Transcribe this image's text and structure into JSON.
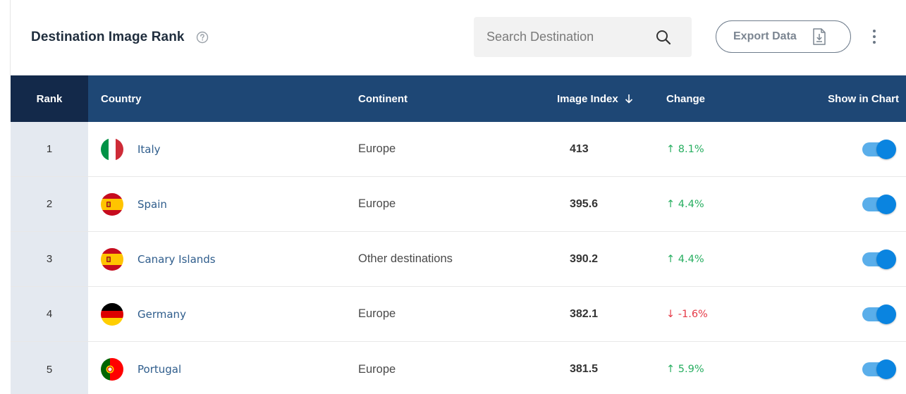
{
  "header": {
    "title": "Destination Image Rank",
    "help_icon": "help-circle-icon",
    "search": {
      "placeholder": "Search Destination",
      "value": "",
      "icon": "search-icon"
    },
    "export": {
      "label": "Export Data",
      "icon": "download-file-icon"
    },
    "more_icon": "more-vertical-icon"
  },
  "table": {
    "columns": {
      "rank": "Rank",
      "country": "Country",
      "continent": "Continent",
      "image_index": "Image Index",
      "change": "Change",
      "show": "Show in Chart"
    },
    "sort": {
      "column": "image_index",
      "direction": "descending",
      "icon": "arrow-down-icon"
    },
    "rows": [
      {
        "rank": "1",
        "country": "Italy",
        "flag": "italy-flag-icon",
        "continent": "Europe",
        "image_index": "413",
        "change": "↑ 8.1%",
        "change_dir": "up",
        "show_in_chart": true
      },
      {
        "rank": "2",
        "country": "Spain",
        "flag": "spain-flag-icon",
        "continent": "Europe",
        "image_index": "395.6",
        "change": "↑ 4.4%",
        "change_dir": "up",
        "show_in_chart": true
      },
      {
        "rank": "3",
        "country": "Canary Islands",
        "flag": "spain-flag-icon",
        "continent": "Other destinations",
        "image_index": "390.2",
        "change": "↑ 4.4%",
        "change_dir": "up",
        "show_in_chart": true
      },
      {
        "rank": "4",
        "country": "Germany",
        "flag": "germany-flag-icon",
        "continent": "Europe",
        "image_index": "382.1",
        "change": "↓ -1.6%",
        "change_dir": "down",
        "show_in_chart": true
      },
      {
        "rank": "5",
        "country": "Portugal",
        "flag": "portugal-flag-icon",
        "continent": "Europe",
        "image_index": "381.5",
        "change": "↑ 5.9%",
        "change_dir": "up",
        "show_in_chart": true
      }
    ]
  },
  "colors": {
    "header_bg": "#1e4775",
    "rank_header_bg": "#13294a",
    "rank_cell_bg": "#e4e9f0",
    "link": "#2f5d8c",
    "up": "#27ae60",
    "down": "#e53946",
    "toggle_on": "#0a84e0"
  }
}
